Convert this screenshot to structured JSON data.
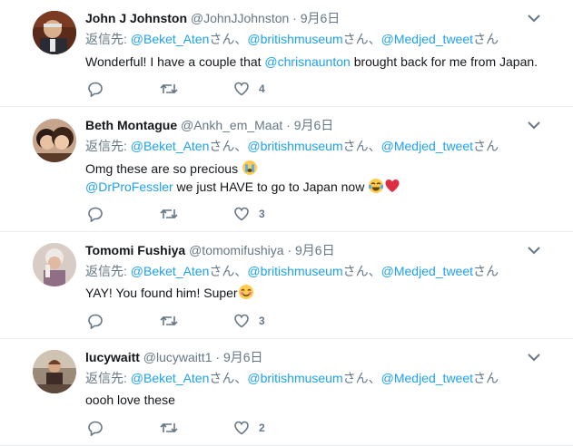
{
  "colors": {
    "link": "#1da1f2",
    "muted": "#657786",
    "divider": "#e6ecf0"
  },
  "tweets": [
    {
      "name": "John J Johnston",
      "handle": "@JohnJJohnston",
      "sep": "·",
      "date": "9月6日",
      "reply_prefix": "返信先: ",
      "reply_to": [
        {
          "mention": "@Beket_Aten",
          "suffix": "さん、"
        },
        {
          "mention": "@britishmuseum",
          "suffix": "さん、"
        },
        {
          "mention": "@Medjed_tweet",
          "suffix": "さん"
        }
      ],
      "text": {
        "a": "Wonderful! I have a couple that ",
        "mention": "@chrisnaunton",
        "b": " brought back for me from Japan."
      },
      "like_count": "4"
    },
    {
      "name": "Beth Montague",
      "handle": "@Ankh_em_Maat",
      "sep": "·",
      "date": "9月6日",
      "reply_prefix": "返信先: ",
      "reply_to": [
        {
          "mention": "@Beket_Aten",
          "suffix": "さん、"
        },
        {
          "mention": "@britishmuseum",
          "suffix": "さん、"
        },
        {
          "mention": "@Medjed_tweet",
          "suffix": "さん"
        }
      ],
      "text1": "Omg these are so precious ",
      "text2": {
        "mention": "@DrProFessler",
        "b": " we just HAVE to go to Japan now "
      },
      "like_count": "3"
    },
    {
      "name": "Tomomi Fushiya",
      "handle": "@tomomifushiya",
      "sep": "·",
      "date": "9月6日",
      "reply_prefix": "返信先: ",
      "reply_to": [
        {
          "mention": "@Beket_Aten",
          "suffix": "さん、"
        },
        {
          "mention": "@britishmuseum",
          "suffix": "さん、"
        },
        {
          "mention": "@Medjed_tweet",
          "suffix": "さん"
        }
      ],
      "text": "YAY! You found him! Super",
      "like_count": "3"
    },
    {
      "name": "lucywaitt",
      "handle": "@lucywaitt1",
      "sep": "·",
      "date": "9月6日",
      "reply_prefix": "返信先: ",
      "reply_to": [
        {
          "mention": "@Beket_Aten",
          "suffix": "さん、"
        },
        {
          "mention": "@britishmuseum",
          "suffix": "さん、"
        },
        {
          "mention": "@Medjed_tweet",
          "suffix": "さん"
        }
      ],
      "text": "oooh love these",
      "like_count": "2"
    }
  ]
}
